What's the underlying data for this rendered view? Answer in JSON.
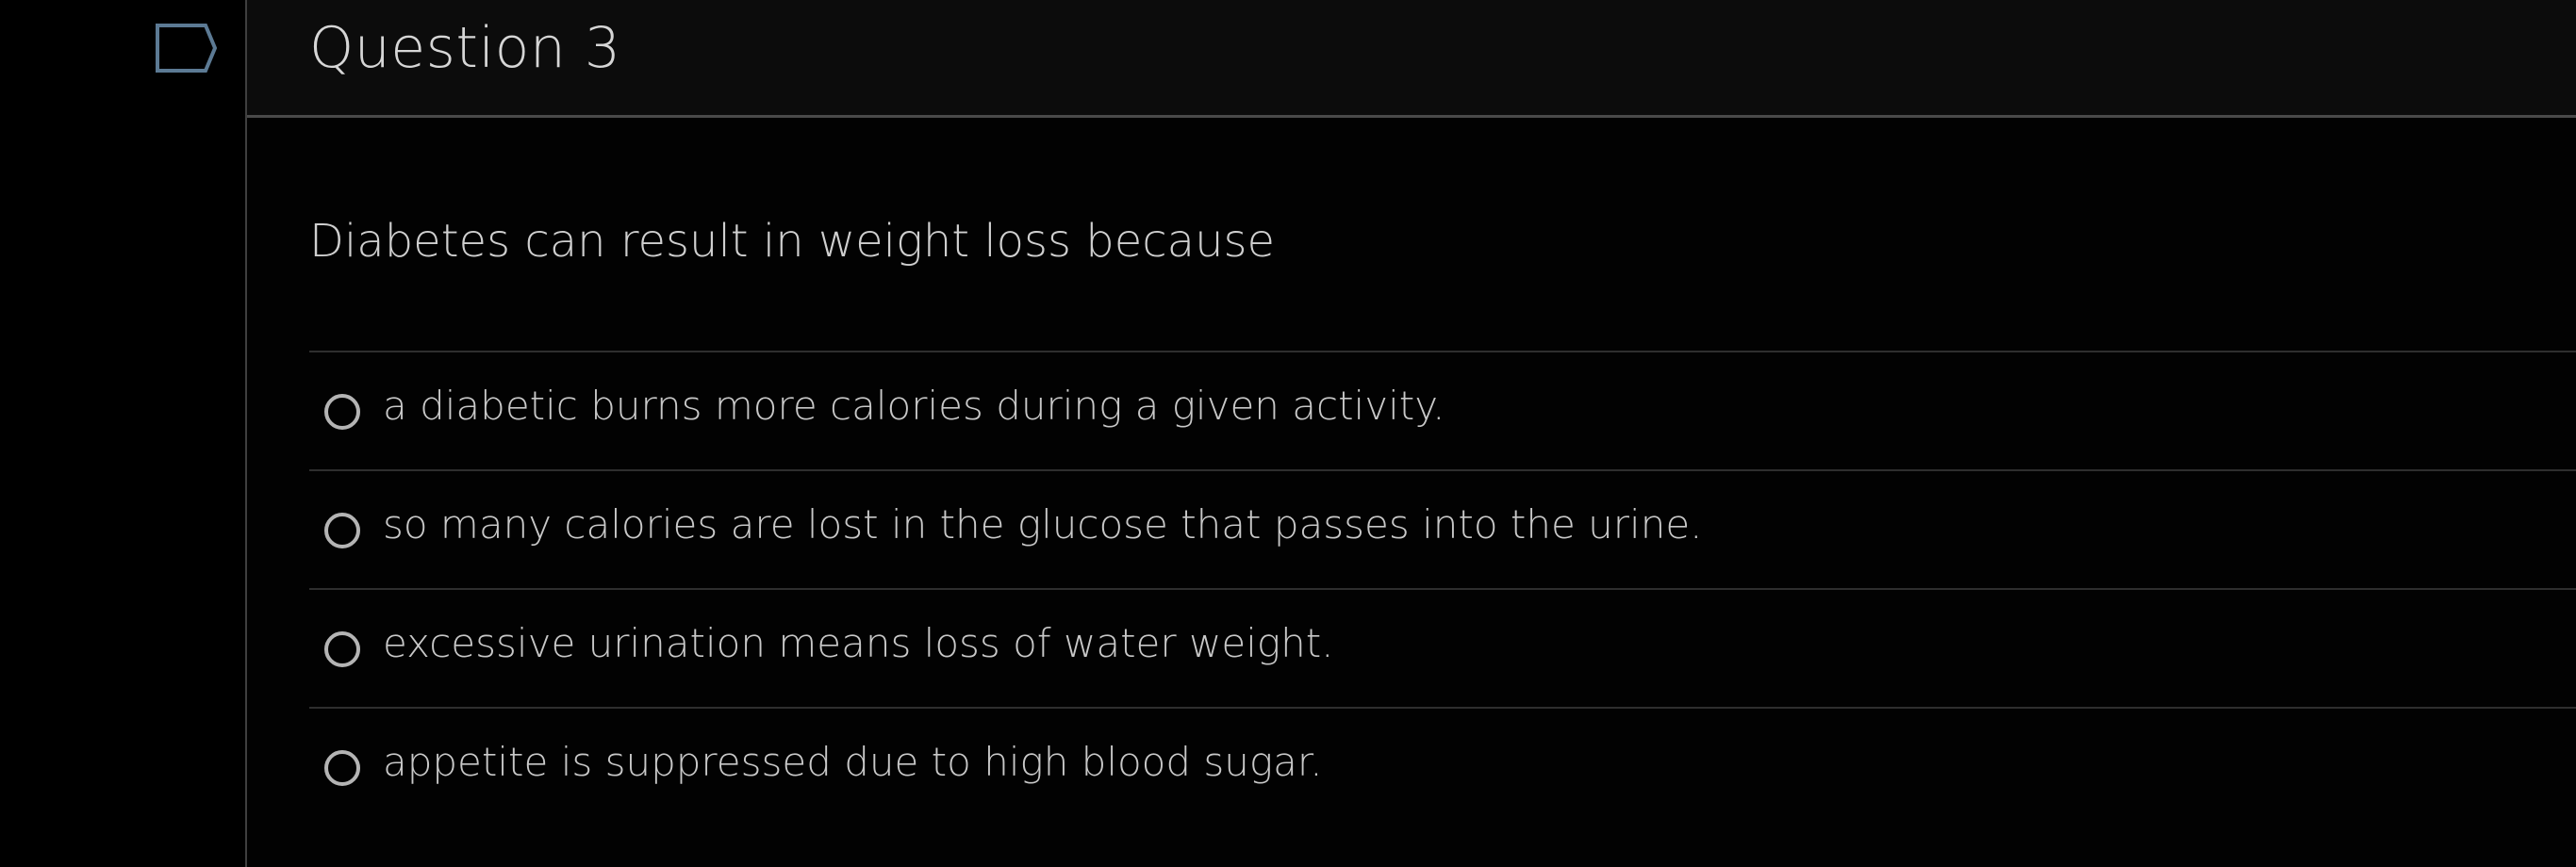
{
  "question": {
    "title": "Question 3",
    "flag_icon": "flag-outline-icon",
    "prompt": "Diabetes can result in weight loss because",
    "answers": [
      {
        "label": "a diabetic burns more calories during a given activity.",
        "selected": false
      },
      {
        "label": "so many calories are lost in the glucose that passes into the urine.",
        "selected": false
      },
      {
        "label": "excessive urination means loss of water weight.",
        "selected": false
      },
      {
        "label": "appetite is suppressed due to high blood sugar.",
        "selected": false
      }
    ]
  },
  "colors": {
    "background": "#000000",
    "header_background": "#0c0c0c",
    "flag_stroke": "#5c7a94",
    "text": "#c8c8c8",
    "radio_stroke": "#b4b4b4",
    "divider": "#2e2e2e"
  }
}
